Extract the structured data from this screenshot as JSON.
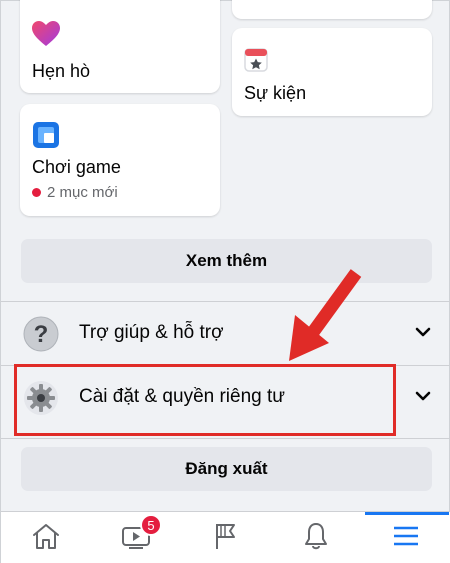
{
  "shortcuts": {
    "dating": {
      "label": "Hẹn hò",
      "icon": "dating-heart-icon"
    },
    "events": {
      "label": "Sự kiện",
      "icon": "calendar-star-icon"
    },
    "gaming": {
      "label": "Chơi game",
      "icon": "gaming-icon",
      "new_count_text": "2 mục mới"
    }
  },
  "see_more_label": "Xem thêm",
  "menu": {
    "help": {
      "label": "Trợ giúp & hỗ trợ",
      "icon": "question-icon"
    },
    "settings": {
      "label": "Cài đặt & quyền riêng tư",
      "icon": "gear-icon"
    }
  },
  "logout_label": "Đăng xuất",
  "tabbar": {
    "active_tab": "menu",
    "watch_badge": "5",
    "tabs": [
      "home-icon",
      "watch-icon",
      "pages-flag-icon",
      "notifications-bell-icon",
      "menu-hamburger-icon"
    ]
  },
  "colors": {
    "accent": "#1877f2",
    "highlight": "#e02b27",
    "badge": "#e41e3f"
  }
}
